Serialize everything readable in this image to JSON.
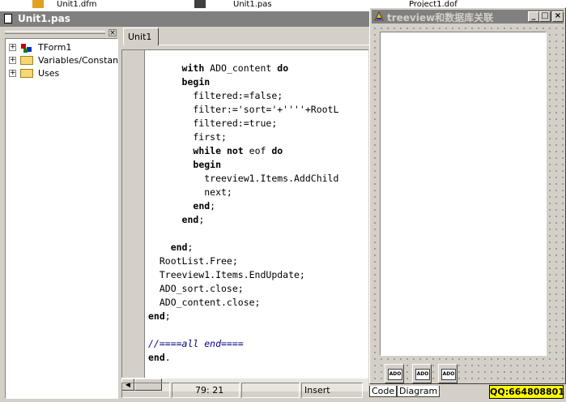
{
  "desktop": {
    "items": [
      "Unit1.dfm",
      "Unit1.pas",
      "Project1.dof"
    ]
  },
  "main_window": {
    "title": "Unit1.pas"
  },
  "explorer": {
    "close_glyph": "×",
    "nodes": [
      {
        "label": "TForm1",
        "expander": "+"
      },
      {
        "label": "Variables/Constants",
        "expander": "+"
      },
      {
        "label": "Uses",
        "expander": "+"
      }
    ]
  },
  "editor": {
    "tab": "Unit1",
    "lines": [
      "      with ADO_content do",
      "      begin",
      "        filtered:=false;",
      "        filter:='sort='+''''+RootL",
      "        filtered:=true;",
      "        first;",
      "        while not eof do",
      "        begin",
      "          treeview1.Items.AddChild",
      "          next;",
      "        end;",
      "      end;",
      "",
      "    end;",
      "  RootList.Free;",
      "  Treeview1.Items.EndUpdate;",
      "  ADO_sort.close;",
      "  ADO_content.close;",
      "end;",
      "",
      "//====all end====",
      "end."
    ]
  },
  "status": {
    "position": "79: 21",
    "mode": "Insert"
  },
  "form_window": {
    "title": "treeview和数据库关联",
    "buttons": {
      "minimize": "_",
      "maximize": "□",
      "close": "×"
    },
    "components": [
      "ADO",
      "ADO",
      "ADO"
    ]
  },
  "bottom_tabs": [
    "Code",
    "Diagram"
  ],
  "watermark": "QQ:664808801"
}
